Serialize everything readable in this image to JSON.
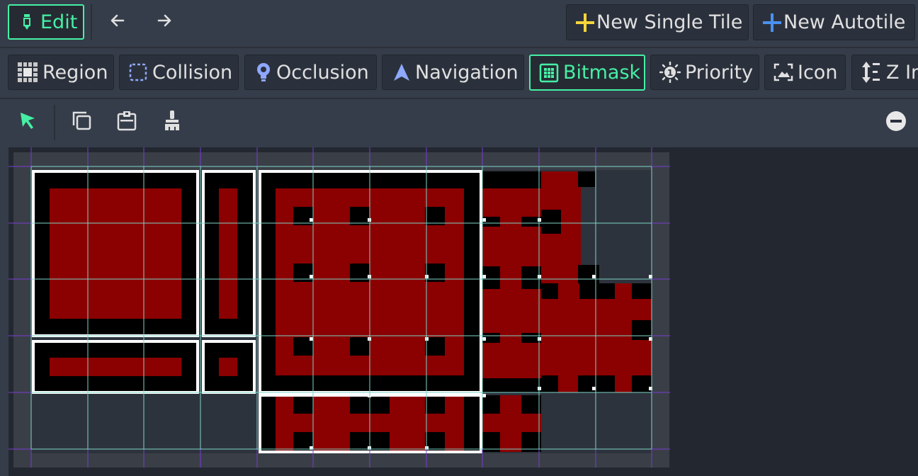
{
  "toolbar": {
    "edit_label": "Edit",
    "new_single_tile_label": "New Single Tile",
    "new_autotile_label": "New Autotile"
  },
  "modes": {
    "region": "Region",
    "collision": "Collision",
    "occlusion": "Occlusion",
    "navigation": "Navigation",
    "bitmask": "Bitmask",
    "priority": "Priority",
    "icon": "Icon",
    "z_index": "Z In"
  },
  "active_mode": "Bitmask",
  "colors": {
    "accent": "#45f0a5",
    "tile_red": "#8b0000",
    "tile_black": "#000000",
    "region_white": "#ffffff",
    "grid_cyan": "#7fd6c8",
    "grid_purple": "#7a3bd6",
    "plus_yellow": "#f5d53a",
    "plus_blue": "#4a90f0"
  },
  "icons": {
    "edit": "pencil-icon",
    "back": "arrow-left-icon",
    "forward": "arrow-right-icon",
    "select": "pointer-icon",
    "copy": "copy-icon",
    "paste": "paste-icon",
    "erase": "brush-icon",
    "zoom_out": "zoom-out-icon"
  }
}
